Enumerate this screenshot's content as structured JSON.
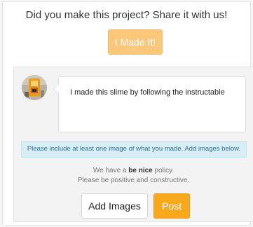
{
  "header": {
    "prompt": "Did you make this project? Share it with us!",
    "made_button_label": "I Made It!"
  },
  "comment": {
    "text": "I made this slime by following the instructable",
    "avatar_icon": "user-avatar-icon"
  },
  "notice": {
    "text": "Please include at least one image of what you made. Add images below."
  },
  "policy": {
    "prefix": "We have a ",
    "emphasis": "be nice",
    "suffix": " policy.",
    "line2": "Please be positive and constructive."
  },
  "actions": {
    "add_images_label": "Add Images",
    "post_label": "Post"
  },
  "colors": {
    "made_button": "#fbc77a",
    "post_button": "#f7a81b",
    "notice_bg": "#d9edf7",
    "notice_text": "#31708f"
  }
}
